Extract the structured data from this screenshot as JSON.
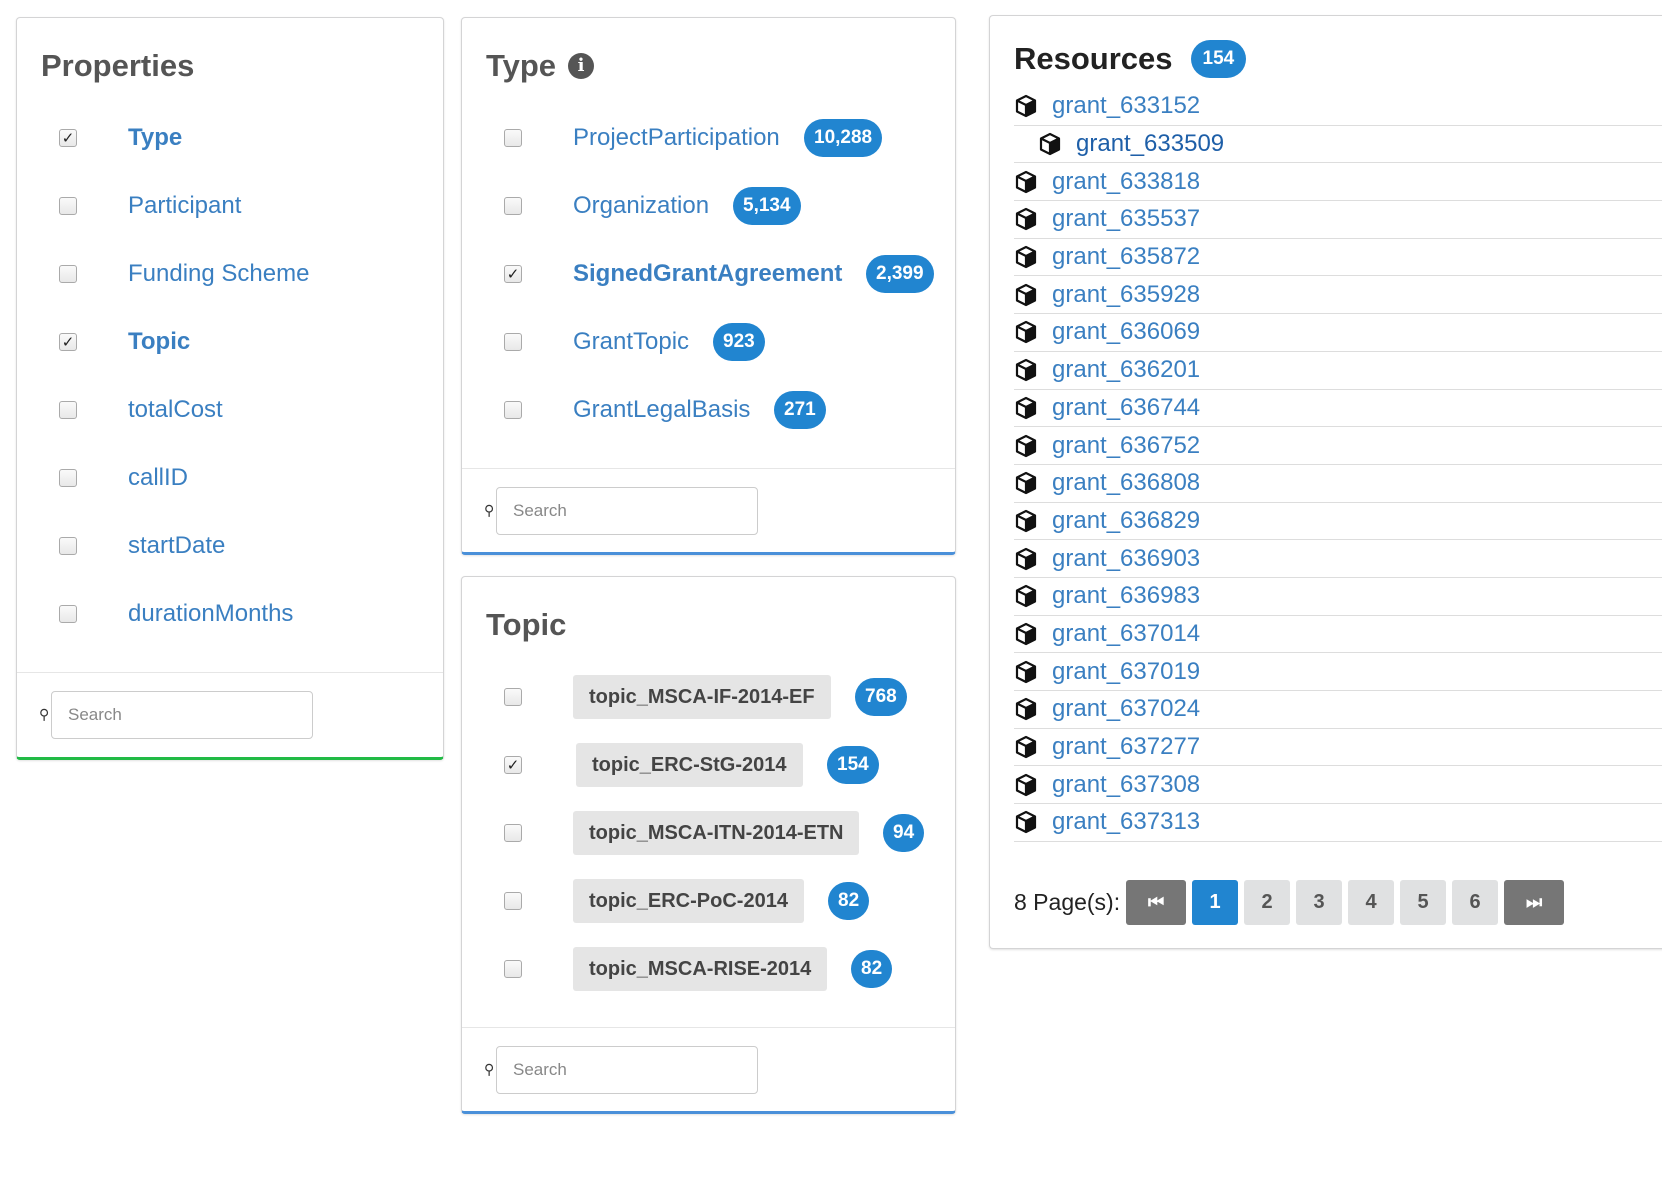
{
  "properties": {
    "title": "Properties",
    "items": [
      {
        "label": "Type",
        "checked": true
      },
      {
        "label": "Participant",
        "checked": false
      },
      {
        "label": "Funding Scheme",
        "checked": false
      },
      {
        "label": "Topic",
        "checked": true
      },
      {
        "label": "totalCost",
        "checked": false
      },
      {
        "label": "callID",
        "checked": false
      },
      {
        "label": "startDate",
        "checked": false
      },
      {
        "label": "durationMonths",
        "checked": false
      }
    ],
    "search_placeholder": "Search"
  },
  "type_facet": {
    "title": "Type",
    "info_icon": "info-circle-icon",
    "items": [
      {
        "label": "ProjectParticipation",
        "count": "10,288",
        "checked": false
      },
      {
        "label": "Organization",
        "count": "5,134",
        "checked": false
      },
      {
        "label": "SignedGrantAgreement",
        "count": "2,399",
        "checked": true
      },
      {
        "label": "GrantTopic",
        "count": "923",
        "checked": false
      },
      {
        "label": "GrantLegalBasis",
        "count": "271",
        "checked": false
      }
    ],
    "search_placeholder": "Search"
  },
  "topic_facet": {
    "title": "Topic",
    "items": [
      {
        "label": "topic_MSCA-IF-2014-EF",
        "count": "768",
        "checked": false
      },
      {
        "label": "topic_ERC-StG-2014",
        "count": "154",
        "checked": true
      },
      {
        "label": "topic_MSCA-ITN-2014-ETN",
        "count": "94",
        "checked": false
      },
      {
        "label": "topic_ERC-PoC-2014",
        "count": "82",
        "checked": false
      },
      {
        "label": "topic_MSCA-RISE-2014",
        "count": "82",
        "checked": false
      }
    ],
    "search_placeholder": "Search"
  },
  "resources": {
    "title": "Resources",
    "count": "154",
    "items": [
      {
        "label": "grant_633152",
        "nested": false
      },
      {
        "label": "grant_633509",
        "nested": true
      },
      {
        "label": "grant_633818",
        "nested": false
      },
      {
        "label": "grant_635537",
        "nested": false
      },
      {
        "label": "grant_635872",
        "nested": false
      },
      {
        "label": "grant_635928",
        "nested": false
      },
      {
        "label": "grant_636069",
        "nested": false
      },
      {
        "label": "grant_636201",
        "nested": false
      },
      {
        "label": "grant_636744",
        "nested": false
      },
      {
        "label": "grant_636752",
        "nested": false
      },
      {
        "label": "grant_636808",
        "nested": false
      },
      {
        "label": "grant_636829",
        "nested": false
      },
      {
        "label": "grant_636903",
        "nested": false
      },
      {
        "label": "grant_636983",
        "nested": false
      },
      {
        "label": "grant_637014",
        "nested": false
      },
      {
        "label": "grant_637019",
        "nested": false
      },
      {
        "label": "grant_637024",
        "nested": false
      },
      {
        "label": "grant_637277",
        "nested": false
      },
      {
        "label": "grant_637308",
        "nested": false
      },
      {
        "label": "grant_637313",
        "nested": false
      }
    ],
    "item_icon": "cube-icon",
    "pagination": {
      "label": "8 Page(s):",
      "first_icon": "first-page-icon",
      "last_icon": "last-page-icon",
      "pages": [
        "1",
        "2",
        "3",
        "4",
        "5",
        "6"
      ],
      "active_page": "1"
    }
  },
  "colors": {
    "link": "#3a7fc1",
    "badge": "#2185d0",
    "properties_accent": "#21ba45",
    "facet_accent": "#4a90d9"
  }
}
